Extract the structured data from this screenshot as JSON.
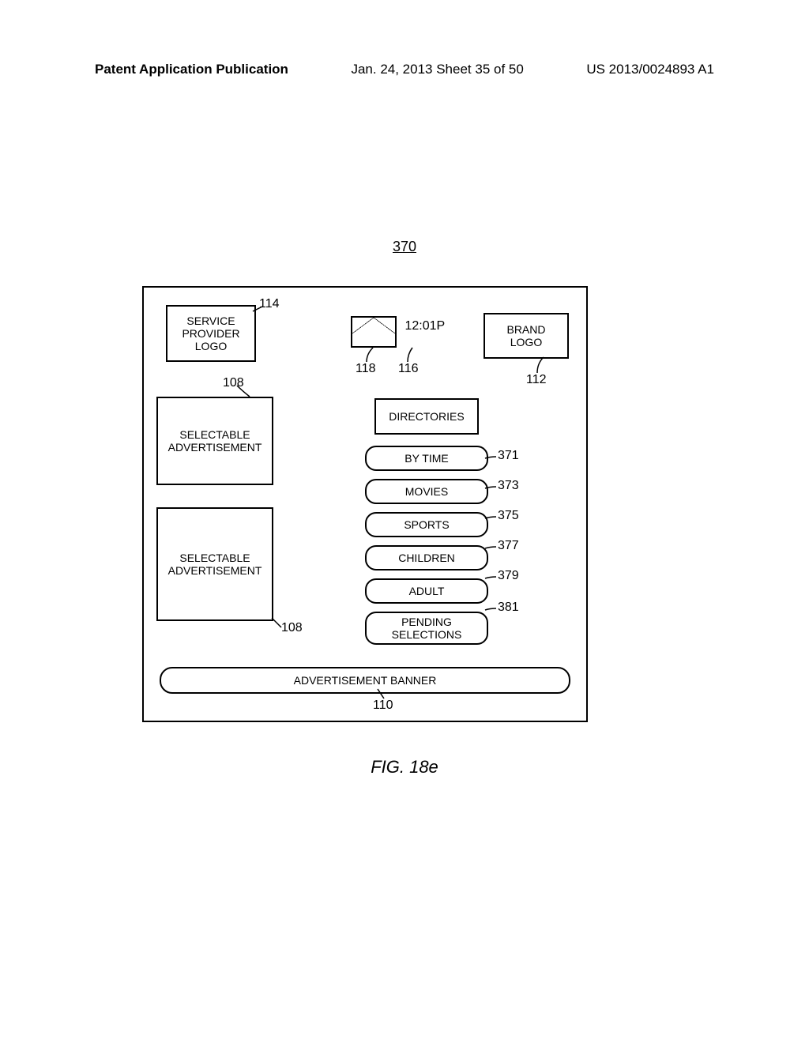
{
  "header": {
    "left": "Patent Application Publication",
    "mid": "Jan. 24, 2013  Sheet 35 of 50",
    "right": "US 2013/0024893 A1"
  },
  "figure_ref": "370",
  "sp_logo": "SERVICE\nPROVIDER\nLOGO",
  "brand_logo": "BRAND\nLOGO",
  "time": "12:01P",
  "ad1": "SELECTABLE\nADVERTISEMENT",
  "ad2": "SELECTABLE\nADVERTISEMENT",
  "directories": "DIRECTORIES",
  "menu": [
    "BY TIME",
    "MOVIES",
    "SPORTS",
    "CHILDREN",
    "ADULT",
    "PENDING\nSELECTIONS"
  ],
  "banner": "ADVERTISEMENT BANNER",
  "refs": {
    "r114": "114",
    "r118": "118",
    "r116": "116",
    "r112": "112",
    "r108a": "108",
    "r108b": "108",
    "r371": "371",
    "r373": "373",
    "r375": "375",
    "r377": "377",
    "r379": "379",
    "r381": "381",
    "r110": "110"
  },
  "fig_caption": "FIG. 18e"
}
